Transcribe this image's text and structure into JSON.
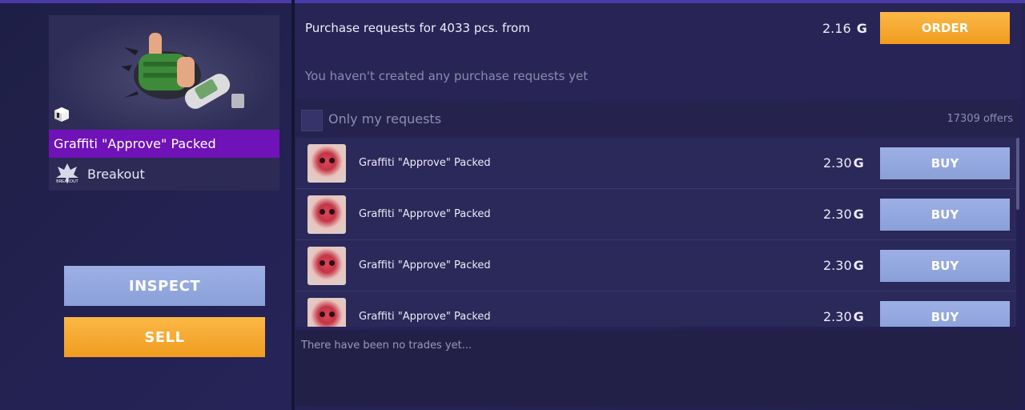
{
  "item": {
    "title": "Graffiti \"Approve\" Packed",
    "collection": "Breakout",
    "collection_logo_text": "BREAKOUT"
  },
  "actions": {
    "inspect_label": "INSPECT",
    "sell_label": "SELL"
  },
  "purchase": {
    "text": "Purchase requests for 4033 pcs. from",
    "price": "2.16",
    "currency_symbol": "G",
    "order_label": "ORDER",
    "empty_text": "You haven't created any purchase requests yet"
  },
  "filter": {
    "label": "Only my requests",
    "offers_count": "17309 offers"
  },
  "offers": [
    {
      "name": "Graffiti \"Approve\" Packed",
      "price": "2.30",
      "currency_symbol": "G",
      "buy_label": "BUY"
    },
    {
      "name": "Graffiti \"Approve\" Packed",
      "price": "2.30",
      "currency_symbol": "G",
      "buy_label": "BUY"
    },
    {
      "name": "Graffiti \"Approve\" Packed",
      "price": "2.30",
      "currency_symbol": "G",
      "buy_label": "BUY"
    },
    {
      "name": "Graffiti \"Approve\" Packed",
      "price": "2.30",
      "currency_symbol": "G",
      "buy_label": "BUY"
    }
  ],
  "trades": {
    "empty_text": "There have been no trades yet..."
  },
  "colors": {
    "accent_orange": "#f5a623",
    "button_blue": "#93a8df",
    "title_purple": "#6f12b8",
    "background": "#232250"
  },
  "icons": {
    "item_preview": "thumbs-up-graffiti-icon",
    "pack": "box-icon",
    "collection": "breakout-logo-icon",
    "currency": "gold-coin-icon"
  }
}
